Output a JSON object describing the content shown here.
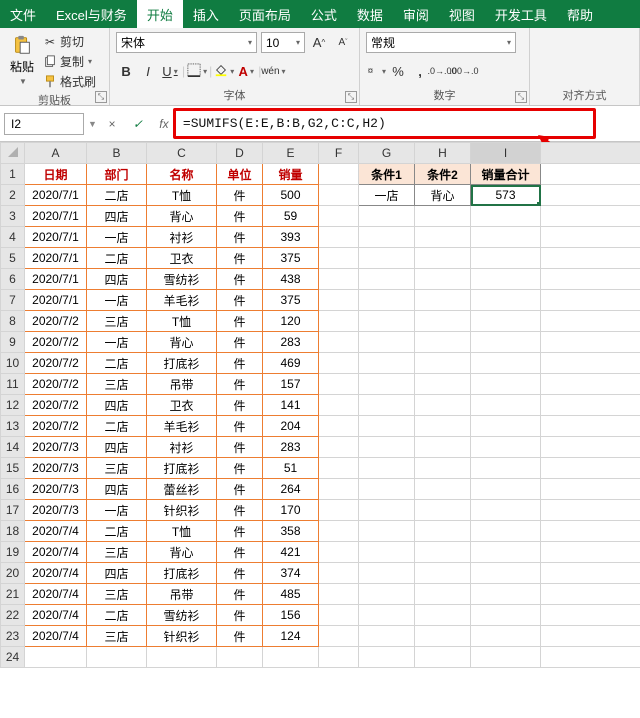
{
  "menu": {
    "file": "文件",
    "excel_finance": "Excel与财务",
    "home": "开始",
    "insert": "插入",
    "layout": "页面布局",
    "formulas": "公式",
    "data": "数据",
    "review": "审阅",
    "view": "视图",
    "dev": "开发工具",
    "help": "帮助"
  },
  "ribbon": {
    "clipboard": {
      "group": "剪贴板",
      "paste": "粘贴",
      "cut": "剪切",
      "copy": "复制",
      "format_painter": "格式刷"
    },
    "font": {
      "group": "字体",
      "font_name": "宋体",
      "font_size": "10",
      "bold": "B",
      "italic": "I",
      "underline": "U"
    },
    "number": {
      "group": "数字",
      "format": "常规"
    },
    "alignment": {
      "group": "对齐方式"
    }
  },
  "namebox": {
    "cell": "I2",
    "cancel": "×",
    "confirm": "✓",
    "fx": "fx"
  },
  "formula": "=SUMIFS(E:E,B:B,G2,C:C,H2)",
  "columns": [
    "A",
    "B",
    "C",
    "D",
    "E",
    "F",
    "G",
    "H",
    "I"
  ],
  "headers": {
    "A": "日期",
    "B": "部门",
    "C": "名称",
    "D": "单位",
    "E": "销量",
    "G": "条件1",
    "H": "条件2",
    "I": "销量合计"
  },
  "side": {
    "G2": "一店",
    "H2": "背心",
    "I2": "573"
  },
  "rows": [
    {
      "n": 2,
      "A": "2020/7/1",
      "B": "二店",
      "C": "T恤",
      "D": "件",
      "E": "500"
    },
    {
      "n": 3,
      "A": "2020/7/1",
      "B": "四店",
      "C": "背心",
      "D": "件",
      "E": "59"
    },
    {
      "n": 4,
      "A": "2020/7/1",
      "B": "一店",
      "C": "衬衫",
      "D": "件",
      "E": "393"
    },
    {
      "n": 5,
      "A": "2020/7/1",
      "B": "二店",
      "C": "卫衣",
      "D": "件",
      "E": "375"
    },
    {
      "n": 6,
      "A": "2020/7/1",
      "B": "四店",
      "C": "雪纺衫",
      "D": "件",
      "E": "438"
    },
    {
      "n": 7,
      "A": "2020/7/1",
      "B": "一店",
      "C": "羊毛衫",
      "D": "件",
      "E": "375"
    },
    {
      "n": 8,
      "A": "2020/7/2",
      "B": "三店",
      "C": "T恤",
      "D": "件",
      "E": "120"
    },
    {
      "n": 9,
      "A": "2020/7/2",
      "B": "一店",
      "C": "背心",
      "D": "件",
      "E": "283"
    },
    {
      "n": 10,
      "A": "2020/7/2",
      "B": "二店",
      "C": "打底衫",
      "D": "件",
      "E": "469"
    },
    {
      "n": 11,
      "A": "2020/7/2",
      "B": "三店",
      "C": "吊带",
      "D": "件",
      "E": "157"
    },
    {
      "n": 12,
      "A": "2020/7/2",
      "B": "四店",
      "C": "卫衣",
      "D": "件",
      "E": "141"
    },
    {
      "n": 13,
      "A": "2020/7/2",
      "B": "二店",
      "C": "羊毛衫",
      "D": "件",
      "E": "204"
    },
    {
      "n": 14,
      "A": "2020/7/3",
      "B": "四店",
      "C": "衬衫",
      "D": "件",
      "E": "283"
    },
    {
      "n": 15,
      "A": "2020/7/3",
      "B": "三店",
      "C": "打底衫",
      "D": "件",
      "E": "51"
    },
    {
      "n": 16,
      "A": "2020/7/3",
      "B": "四店",
      "C": "蕾丝衫",
      "D": "件",
      "E": "264"
    },
    {
      "n": 17,
      "A": "2020/7/3",
      "B": "一店",
      "C": "针织衫",
      "D": "件",
      "E": "170"
    },
    {
      "n": 18,
      "A": "2020/7/4",
      "B": "二店",
      "C": "T恤",
      "D": "件",
      "E": "358"
    },
    {
      "n": 19,
      "A": "2020/7/4",
      "B": "三店",
      "C": "背心",
      "D": "件",
      "E": "421"
    },
    {
      "n": 20,
      "A": "2020/7/4",
      "B": "四店",
      "C": "打底衫",
      "D": "件",
      "E": "374"
    },
    {
      "n": 21,
      "A": "2020/7/4",
      "B": "三店",
      "C": "吊带",
      "D": "件",
      "E": "485"
    },
    {
      "n": 22,
      "A": "2020/7/4",
      "B": "二店",
      "C": "雪纺衫",
      "D": "件",
      "E": "156"
    },
    {
      "n": 23,
      "A": "2020/7/4",
      "B": "三店",
      "C": "针织衫",
      "D": "件",
      "E": "124"
    }
  ]
}
